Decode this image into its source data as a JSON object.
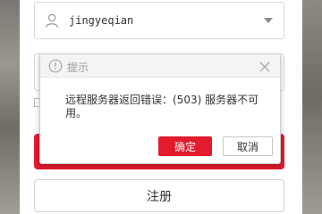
{
  "login_form": {
    "username": "jingyeqian",
    "register_label": "注册"
  },
  "dialog": {
    "title": "提示",
    "message": "远程服务器返回错误：(503) 服务器不可用。",
    "ok_label": "确定",
    "cancel_label": "取消"
  },
  "colors": {
    "accent": "#e21b2d",
    "border": "#d8d8d8"
  },
  "icons": {
    "user": "user-icon",
    "dropdown": "chevron-down-icon",
    "info": "info-icon",
    "close": "close-icon"
  }
}
